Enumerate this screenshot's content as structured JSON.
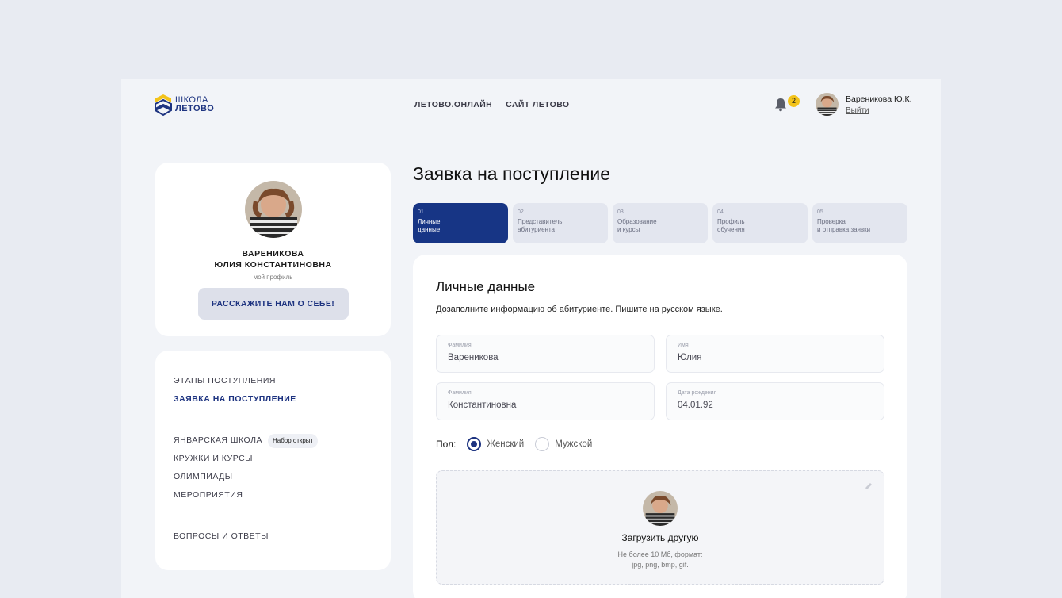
{
  "header": {
    "logo": {
      "line1": "ШКОЛА",
      "line2": "ЛЕТОВО"
    },
    "nav": [
      "ЛЕТОВО.ОНЛАЙН",
      "САЙТ ЛЕТОВО"
    ],
    "notifications": {
      "icon": "bell-icon",
      "count": "2"
    },
    "user": {
      "name": "Вареникова Ю.К.",
      "logout": "Выйти"
    }
  },
  "profile": {
    "name_line1": "ВАРЕНИКОВА",
    "name_line2": "ЮЛИЯ КОНСТАНТИНОВНА",
    "profile_link": "мой профиль",
    "cta_button": "РАССКАЖИТЕ НАМ О СЕБЕ!"
  },
  "sidebar": {
    "group1": [
      "ЭТАПЫ ПОСТУПЛЕНИЯ",
      "ЗАЯВКА НА ПОСТУПЛЕНИЕ"
    ],
    "group2": [
      "ЯНВАРСКАЯ ШКОЛА",
      "КРУЖКИ И КУРСЫ",
      "ОЛИМПИАДЫ",
      "МЕРОПРИЯТИЯ"
    ],
    "group2_badge": "Набор открыт",
    "group3": [
      "ВОПРОСЫ И ОТВЕТЫ"
    ]
  },
  "main": {
    "title": "Заявка на поступление",
    "steps": [
      {
        "num": "01",
        "line1": "Личные",
        "line2": "данные"
      },
      {
        "num": "02",
        "line1": "Представитель",
        "line2": "абитуриента"
      },
      {
        "num": "03",
        "line1": "Образование",
        "line2": "и курсы"
      },
      {
        "num": "04",
        "line1": "Профиль",
        "line2": "обучения"
      },
      {
        "num": "05",
        "line1": "Проверка",
        "line2": "и отправка заявки"
      }
    ],
    "form": {
      "title": "Личные данные",
      "subtitle": "Дозаполните информацию об абитуриенте. Пишите на русском языке.",
      "fields": [
        {
          "label": "Фамилия",
          "value": "Вареникова"
        },
        {
          "label": "Имя",
          "value": "Юлия"
        },
        {
          "label": "Фамилия",
          "value": "Константиновна"
        },
        {
          "label": "Дата рождения",
          "value": "04.01.92"
        }
      ],
      "gender": {
        "label": "Пол:",
        "options": [
          "Женский",
          "Мужской"
        ],
        "selected": "Женский"
      },
      "upload": {
        "title": "Загрузить другую",
        "hint_line1": "Не более 10 Мб, формат:",
        "hint_line2": "jpg, png, bmp, gif."
      }
    }
  },
  "colors": {
    "accent": "#1d3380",
    "active_step": "#173585",
    "badge": "#f3c31a",
    "background": "#e8ebf2"
  }
}
